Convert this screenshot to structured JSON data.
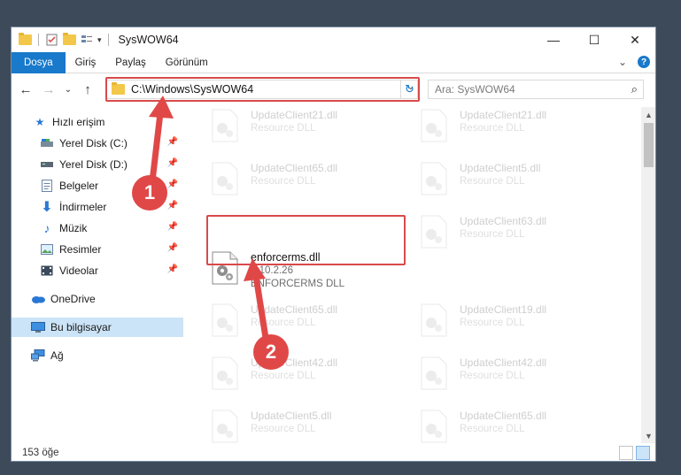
{
  "window": {
    "title": "SysWOW64",
    "minimize": "—",
    "maximize": "☐",
    "close": "✕"
  },
  "ribbon": {
    "tabs": [
      "Dosya",
      "Giriş",
      "Paylaş",
      "Görünüm"
    ],
    "expand": "⌄",
    "help": "?"
  },
  "nav": {
    "back": "←",
    "forward": "→",
    "recent": "⌄",
    "up": "↑",
    "address": "C:\\Windows\\SysWOW64",
    "address_dropdown": "⌄",
    "refresh": "↻",
    "search_placeholder": "Ara: SysWOW64",
    "search_icon": "⌕"
  },
  "sidebar": {
    "items": [
      {
        "label": "Hızlı erişim",
        "icon": "star-icon"
      },
      {
        "label": "Yerel Disk (C:)",
        "icon": "drive-icon",
        "pinned": true
      },
      {
        "label": "Yerel Disk (D:)",
        "icon": "drive-icon",
        "pinned": true
      },
      {
        "label": "Belgeler",
        "icon": "documents-icon",
        "pinned": true
      },
      {
        "label": "İndirmeler",
        "icon": "download-icon",
        "pinned": true
      },
      {
        "label": "Müzik",
        "icon": "music-icon",
        "pinned": true
      },
      {
        "label": "Resimler",
        "icon": "pictures-icon",
        "pinned": true
      },
      {
        "label": "Videolar",
        "icon": "videos-icon",
        "pinned": true
      },
      {
        "label": "OneDrive",
        "icon": "cloud-icon"
      },
      {
        "label": "Bu bilgisayar",
        "icon": "computer-icon",
        "selected": true
      },
      {
        "label": "Ağ",
        "icon": "network-icon"
      }
    ]
  },
  "files": {
    "left": [
      {
        "name": "UpdateClient21.dll",
        "desc": "Resource DLL"
      },
      {
        "name": "UpdateClient65.dll",
        "desc": "Resource DLL"
      },
      {
        "name": "enforcerms.dll",
        "desc": "8.10.2.26",
        "desc2": "ENFORCERMS DLL",
        "highlighted": true
      },
      {
        "name": "UpdateClient65.dll",
        "desc": "Resource DLL"
      },
      {
        "name": "UpdateClient42.dll",
        "desc": "Resource DLL"
      },
      {
        "name": "UpdateClient5.dll",
        "desc": "Resource DLL"
      }
    ],
    "right": [
      {
        "name": "UpdateClient21.dll",
        "desc": "Resource DLL"
      },
      {
        "name": "UpdateClient5.dll",
        "desc": "Resource DLL"
      },
      {
        "name": "UpdateClient63.dll",
        "desc": "Resource DLL"
      },
      {
        "name": "UpdateClient19.dll",
        "desc": "Resource DLL"
      },
      {
        "name": "UpdateClient42.dll",
        "desc": "Resource DLL"
      },
      {
        "name": "UpdateClient65.dll",
        "desc": "Resource DLL"
      }
    ]
  },
  "status": {
    "count": "153 öğe"
  },
  "annotations": {
    "step1": "1",
    "step2": "2",
    "color": "#e04848"
  },
  "colors": {
    "accent": "#1979ca",
    "highlight": "#d94a4a",
    "selected": "#cce4f7"
  }
}
